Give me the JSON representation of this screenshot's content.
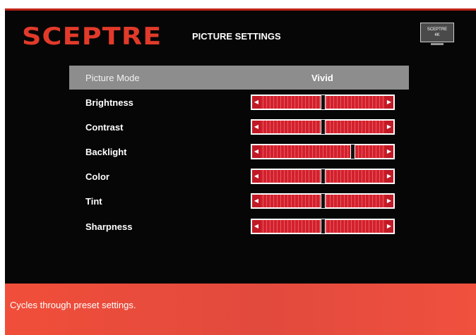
{
  "header": {
    "brand": "SCEPTRE",
    "title": "PICTURE SETTINGS",
    "badge_brand": "SCEPTRE",
    "badge_res": "4K"
  },
  "menu": {
    "picture_mode": {
      "label": "Picture Mode",
      "value": "Vivid"
    },
    "sliders": [
      {
        "label": "Brightness",
        "level": 0.5
      },
      {
        "label": "Contrast",
        "level": 0.5
      },
      {
        "label": "Backlight",
        "level": 0.71
      },
      {
        "label": "Color",
        "level": 0.5
      },
      {
        "label": "Tint",
        "level": 0.5
      },
      {
        "label": "Sharpness",
        "level": 0.5
      }
    ]
  },
  "footer": {
    "hint": "Cycles through preset settings."
  },
  "icons": {
    "left_arrow": "arrow-left-icon",
    "right_arrow": "arrow-right-icon"
  },
  "colors": {
    "accent": "#e23a2a",
    "slider": "#d4202c",
    "footer": "#f04e3a",
    "selected_row": "#8d8d8d"
  }
}
